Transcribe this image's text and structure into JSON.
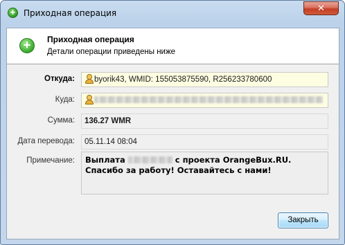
{
  "window": {
    "title": "Приходная операция",
    "close_glyph": "✕"
  },
  "header": {
    "title": "Приходная операция",
    "subtitle": "Детали операции приведены ниже",
    "icon": "plus-icon",
    "icon_glyph": "+"
  },
  "fields": {
    "from": {
      "label": "Откуда:",
      "value": "byorik43, WMID: 155053875590, R256233780600"
    },
    "to": {
      "label": "Куда:",
      "value": ""
    },
    "amount": {
      "label": "Сумма:",
      "value": "136.27 WMR"
    },
    "date": {
      "label": "Дата перевода:",
      "value": "05.11.14 08:04"
    },
    "note": {
      "label": "Примечание:",
      "text_before": "Выплата",
      "text_after": "с проекта OrangeBux.RU. Спасибо за работу! Оставайтесь с нами!"
    }
  },
  "buttons": {
    "close": "Закрыть"
  },
  "colors": {
    "highlight_field": "#fdfde2",
    "accent_green": "#3fae32",
    "close_red": "#c33e24"
  }
}
